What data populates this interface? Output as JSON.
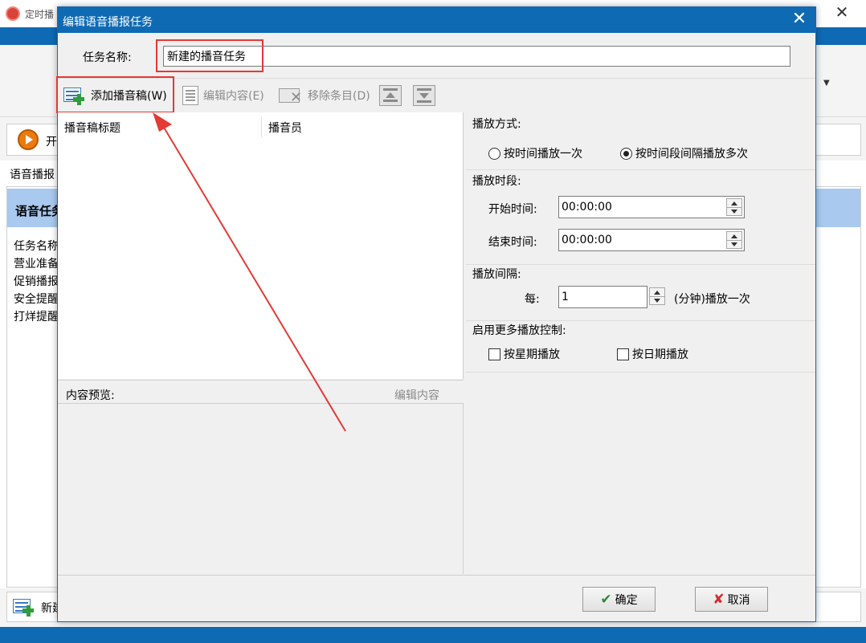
{
  "background_window": {
    "title": "定时播",
    "start_button_label": "开",
    "section_label": "语音播报",
    "panel_header": "语音任务",
    "task_list": [
      "任务名称",
      "营业准备",
      "促销播报",
      "安全提醒",
      "打烊提醒"
    ],
    "new_button_label": "新建"
  },
  "dialog": {
    "title": "编辑语音播报任务",
    "close_icon": "close-icon",
    "task_name_label": "任务名称:",
    "task_name_value": "新建的播音任务",
    "toolbar": {
      "add_script": "添加播音稿(W)",
      "edit_content": "编辑内容(E)",
      "remove_item": "移除条目(D)",
      "move_up_icon": "move-up-icon",
      "move_down_icon": "move-down-icon"
    },
    "list": {
      "columns": [
        "播音稿标题",
        "播音员"
      ],
      "rows": []
    },
    "preview": {
      "label": "内容预览:",
      "edit_link": "编辑内容"
    },
    "settings": {
      "play_mode": {
        "label": "播放方式:",
        "options": [
          {
            "label": "按时间播放一次",
            "selected": false
          },
          {
            "label": "按时间段间隔播放多次",
            "selected": true
          }
        ]
      },
      "play_period": {
        "label": "播放时段:",
        "start_label": "开始时间:",
        "start_value": "00:00:00",
        "end_label": "结束时间:",
        "end_value": "00:00:00"
      },
      "play_interval": {
        "label": "播放间隔:",
        "every_label": "每:",
        "every_value": "1",
        "suffix": "(分钟)播放一次"
      },
      "more_control": {
        "label": "启用更多播放控制:",
        "by_weekday": "按星期播放",
        "by_weekday_checked": false,
        "by_date": "按日期播放",
        "by_date_checked": false
      }
    },
    "buttons": {
      "ok": "确定",
      "cancel": "取消"
    }
  },
  "colors": {
    "titlebar": "#0f6ab4",
    "highlight": "#e53935",
    "panel_header": "#a9c9ee"
  }
}
